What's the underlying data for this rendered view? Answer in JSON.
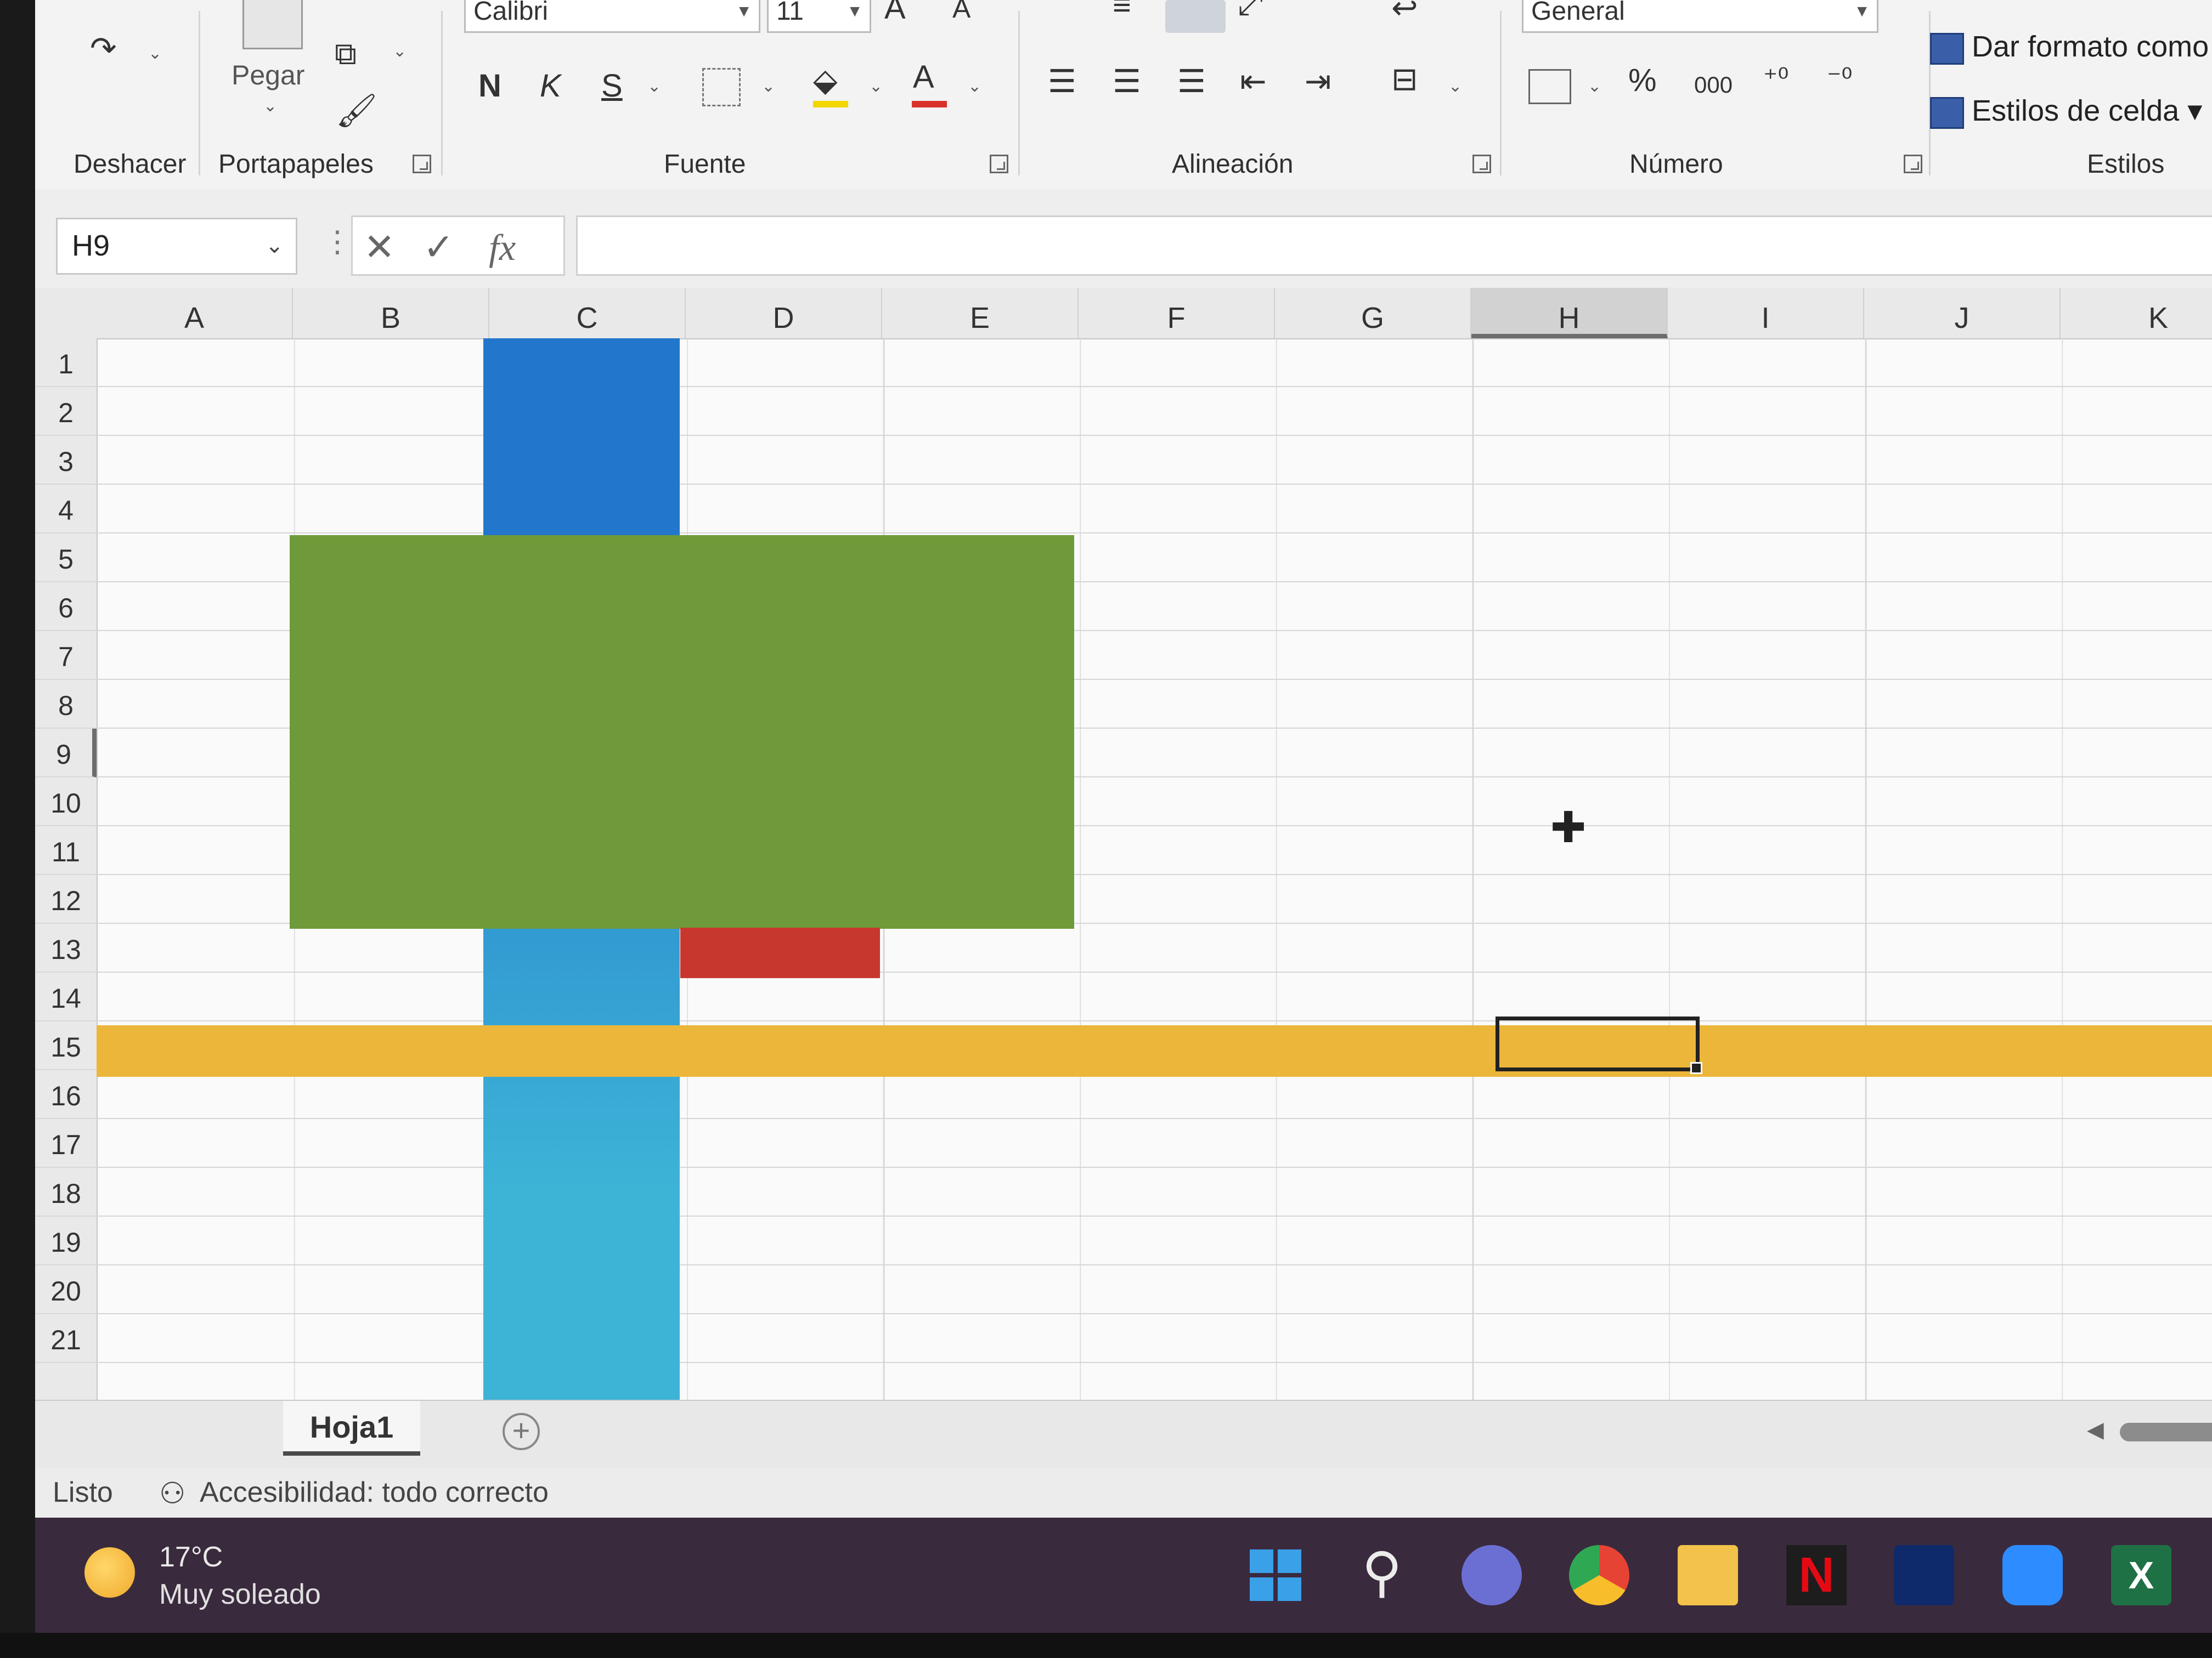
{
  "ribbon": {
    "undo_label": "Deshacer",
    "paste_label": "Pegar",
    "clipboard_label": "Portapapeles",
    "font_name": "Calibri",
    "font_size": "11",
    "bold_label": "N",
    "italic_label": "K",
    "underline_label": "S",
    "font_color_glyph": "A",
    "font_group_label": "Fuente",
    "alignment_group_label": "Alineación",
    "number_format": "General",
    "percent_glyph": "%",
    "thousands_glyph": "000",
    "number_group_label": "Número",
    "format_as_table_label": "Dar formato como",
    "cell_styles_label": "Estilos de celda",
    "styles_group_label": "Estilos"
  },
  "formula_bar": {
    "name_box": "H9",
    "cancel_glyph": "✕",
    "enter_glyph": "✓",
    "fx_glyph": "fx",
    "formula": ""
  },
  "sheet": {
    "columns": [
      "A",
      "B",
      "C",
      "D",
      "E",
      "F",
      "G",
      "H",
      "I",
      "J",
      "K"
    ],
    "rows": [
      "1",
      "2",
      "3",
      "4",
      "5",
      "6",
      "7",
      "8",
      "9",
      "10",
      "11",
      "12",
      "13",
      "14",
      "15",
      "16",
      "17",
      "18",
      "19",
      "20",
      "21"
    ],
    "selected_column": "H",
    "selected_row": "9",
    "shape_colors": {
      "blue_top": "#2277cc",
      "blue_bottom": "#3db3d6",
      "green": "#6f9a3a",
      "red": "#c8372d",
      "yellow": "#ebb63a"
    }
  },
  "tabs": {
    "sheet_name": "Hoja1",
    "add_sheet_glyph": "+"
  },
  "status": {
    "ready": "Listo",
    "accessibility": "Accesibilidad: todo correcto"
  },
  "taskbar": {
    "temperature": "17°C",
    "weather": "Muy soleado",
    "icons": [
      "windows-start-icon",
      "search-icon",
      "chat-icon",
      "chrome-icon",
      "file-explorer-icon",
      "netflix-icon",
      "disney-plus-icon",
      "zoom-icon",
      "excel-icon"
    ]
  }
}
